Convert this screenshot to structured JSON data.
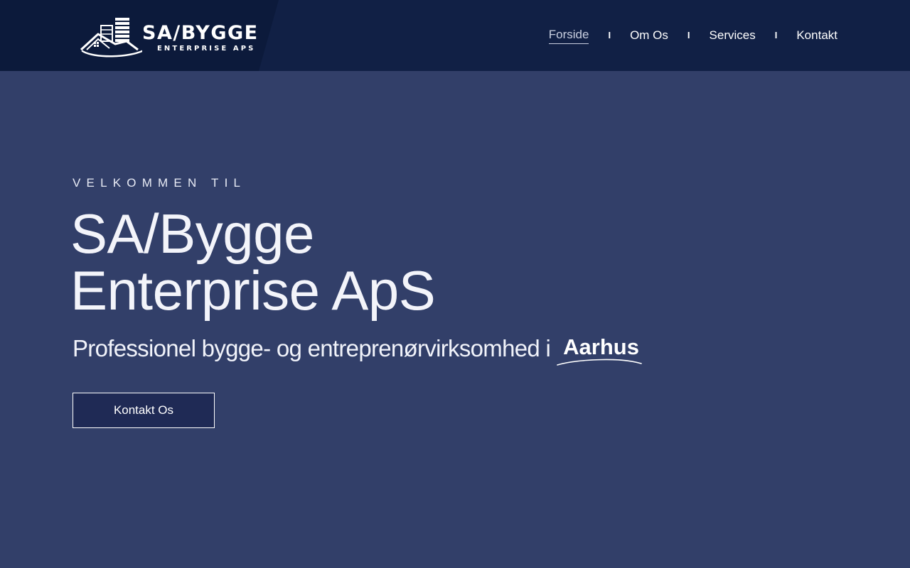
{
  "header": {
    "logo": {
      "title": "SA/BYGGE",
      "subtitle": "ENTERPRISE APS"
    },
    "nav": [
      {
        "label": "Forside",
        "active": true
      },
      {
        "label": "Om Os",
        "active": false
      },
      {
        "label": "Services",
        "active": false
      },
      {
        "label": "Kontakt",
        "active": false
      }
    ],
    "separator": "I"
  },
  "hero": {
    "eyebrow": "VELKOMMEN TIL",
    "title_line1": "SA/Bygge",
    "title_line2": "Enterprise ApS",
    "tagline": "Professionel bygge- og entreprenørvirksomhed i",
    "city": "Aarhus",
    "cta_label": "Kontakt Os"
  },
  "colors": {
    "header_bg": "#112045",
    "page_bg": "#323f69",
    "button_bg": "#1f2a55",
    "text": "#ffffff"
  },
  "icons": {
    "logo_mark": "house-with-buildings-icon"
  }
}
